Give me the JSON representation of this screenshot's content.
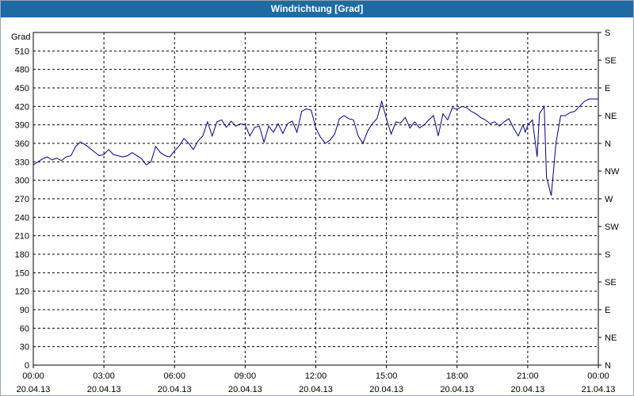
{
  "window": {
    "title": "Windrichtung [Grad]"
  },
  "chart_data": {
    "type": "line",
    "title": "Windrichtung [Grad]",
    "ylabel": "Grad",
    "ylim": [
      0,
      540
    ],
    "yticks": [
      0,
      30,
      60,
      90,
      120,
      150,
      180,
      210,
      240,
      270,
      300,
      330,
      360,
      390,
      420,
      450,
      480,
      510
    ],
    "right_axis_labels": [
      "N",
      "NE",
      "E",
      "SE",
      "S",
      "SW",
      "W",
      "NW",
      "N",
      "NE",
      "E",
      "SE",
      "S"
    ],
    "xlim": [
      0,
      24
    ],
    "xticks": [
      {
        "value": 0,
        "time": "00:00",
        "date": "20.04.13"
      },
      {
        "value": 3,
        "time": "03:00",
        "date": "20.04.13"
      },
      {
        "value": 6,
        "time": "06:00",
        "date": "20.04.13"
      },
      {
        "value": 9,
        "time": "09:00",
        "date": "20.04.13"
      },
      {
        "value": 12,
        "time": "12:00",
        "date": "20.04.13"
      },
      {
        "value": 15,
        "time": "15:00",
        "date": "20.04.13"
      },
      {
        "value": 18,
        "time": "18:00",
        "date": "20.04.13"
      },
      {
        "value": 21,
        "time": "21:00",
        "date": "20.04.13"
      },
      {
        "value": 24,
        "time": "00:00",
        "date": "21.04.13"
      }
    ],
    "grid": true,
    "line_color": "#00008b",
    "series": [
      {
        "name": "",
        "x": [
          0,
          0.2,
          0.4,
          0.6,
          0.8,
          1.0,
          1.2,
          1.4,
          1.6,
          1.8,
          2.0,
          2.2,
          2.4,
          2.6,
          2.8,
          3.0,
          3.2,
          3.4,
          3.6,
          3.8,
          4.0,
          4.2,
          4.4,
          4.6,
          4.8,
          5.0,
          5.2,
          5.4,
          5.6,
          5.8,
          6.0,
          6.2,
          6.4,
          6.6,
          6.8,
          7.0,
          7.2,
          7.4,
          7.6,
          7.8,
          8.0,
          8.2,
          8.4,
          8.6,
          8.8,
          9.0,
          9.2,
          9.4,
          9.6,
          9.8,
          10.0,
          10.2,
          10.4,
          10.6,
          10.8,
          11.0,
          11.2,
          11.4,
          11.6,
          11.8,
          12.0,
          12.2,
          12.4,
          12.6,
          12.8,
          13.0,
          13.2,
          13.4,
          13.6,
          13.8,
          14.0,
          14.2,
          14.4,
          14.6,
          14.8,
          15.0,
          15.2,
          15.4,
          15.6,
          15.8,
          16.0,
          16.2,
          16.4,
          16.6,
          16.8,
          17.0,
          17.2,
          17.4,
          17.6,
          17.8,
          18.0,
          18.2,
          18.4,
          18.6,
          18.8,
          19.0,
          19.2,
          19.4,
          19.6,
          19.8,
          20.0,
          20.2,
          20.4,
          20.6,
          20.8,
          20.9,
          21.0,
          21.2,
          21.4,
          21.5,
          21.6,
          21.7,
          21.8,
          22.0,
          22.2,
          22.4,
          22.6,
          22.8,
          23.0,
          23.2,
          23.4,
          23.6,
          23.8,
          24.0
        ],
        "y": [
          325,
          330,
          335,
          338,
          333,
          336,
          332,
          338,
          340,
          355,
          362,
          358,
          352,
          346,
          340,
          342,
          350,
          342,
          340,
          338,
          340,
          345,
          340,
          335,
          325,
          330,
          355,
          345,
          340,
          338,
          348,
          356,
          368,
          360,
          350,
          364,
          372,
          395,
          372,
          395,
          398,
          386,
          396,
          388,
          392,
          390,
          372,
          386,
          388,
          362,
          388,
          378,
          392,
          376,
          392,
          396,
          378,
          412,
          416,
          414,
          385,
          370,
          360,
          365,
          375,
          400,
          405,
          400,
          398,
          372,
          360,
          380,
          392,
          400,
          428,
          400,
          375,
          395,
          393,
          402,
          385,
          395,
          385,
          390,
          398,
          405,
          372,
          408,
          398,
          418,
          415,
          420,
          418,
          412,
          408,
          402,
          398,
          392,
          395,
          388,
          395,
          400,
          385,
          372,
          390,
          378,
          390,
          398,
          338,
          408,
          414,
          420,
          305,
          275,
          360,
          405,
          405,
          410,
          412,
          420,
          428,
          432,
          432,
          432
        ]
      }
    ]
  }
}
